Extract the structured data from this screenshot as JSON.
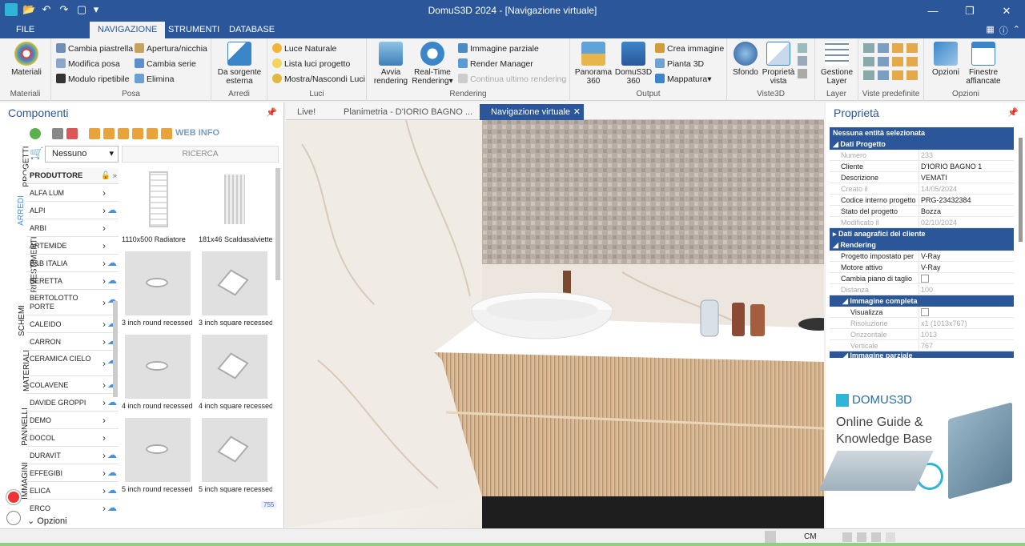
{
  "window": {
    "title": "DomuS3D 2024 - [Navigazione virtuale]",
    "controls": [
      "minimize-icon",
      "restore-icon",
      "close-icon"
    ]
  },
  "ribbon_tabs": [
    {
      "label": "FILE",
      "active": false
    },
    {
      "label": "NAVIGAZIONE",
      "active": true
    },
    {
      "label": "STRUMENTI",
      "active": false
    },
    {
      "label": "DATABASE",
      "active": false
    }
  ],
  "ribbon": {
    "materiali": {
      "btn": "Materiali",
      "group": "Materiali"
    },
    "posa": {
      "items": [
        "Cambia piastrella",
        "Modifica posa",
        "Modulo ripetibile",
        "Apertura/nicchia",
        "Cambia serie",
        "Elimina"
      ],
      "group": "Posa"
    },
    "arredi": {
      "btn_line1": "Da sorgente",
      "btn_line2": "esterna",
      "group": "Arredi"
    },
    "luci": {
      "items": [
        "Luce Naturale",
        "Lista luci progetto",
        "Mostra/Nascondi Luci"
      ],
      "group": "Luci"
    },
    "rendering": {
      "avvia_1": "Avvia",
      "avvia_2": "rendering",
      "rt_1": "Real-Time",
      "rt_2": "Rendering",
      "items": [
        "Immagine parziale",
        "Render Manager",
        "Continua ultimo rendering"
      ],
      "group": "Rendering"
    },
    "output": {
      "pan_1": "Panorama",
      "pan_2": "360",
      "dom_1": "DomuS3D",
      "dom_2": "360",
      "items": [
        "Crea immagine",
        "Pianta 3D",
        "Mappatura"
      ],
      "group": "Output"
    },
    "viste3d": {
      "sfondo": "Sfondo",
      "prop_1": "Proprietà",
      "prop_2": "vista",
      "group": "Viste3D"
    },
    "layer": {
      "btn_1": "Gestione",
      "btn_2": "Layer",
      "group": "Layer"
    },
    "viste_predefinite": {
      "group": "Viste predefinite"
    },
    "opzioni": {
      "btn": "Opzioni",
      "fin_1": "Finestre",
      "fin_2": "affiancate",
      "group": "Opzioni"
    }
  },
  "left_panel": {
    "title": "Componenti",
    "webinfo": "WEB INFO",
    "dropdown_value": "Nessuno",
    "search_placeholder": "RICERCA",
    "vertical_tabs": [
      "PROGETTI",
      "ARREDI",
      "RIVESTIMENTI",
      "SCHEMI",
      "MATERIALI",
      "PANNELLI",
      "IMMAGINI"
    ],
    "list_header": "PRODUTTORE",
    "producers": [
      {
        "name": "ALFA LUM",
        "cloud": false
      },
      {
        "name": "ALPI",
        "cloud": true
      },
      {
        "name": "ARBI",
        "cloud": false
      },
      {
        "name": "ARTEMIDE",
        "cloud": false
      },
      {
        "name": "B&B ITALIA",
        "cloud": true
      },
      {
        "name": "BERETTA",
        "cloud": true
      },
      {
        "name": "BERTOLOTTO PORTE",
        "cloud": true
      },
      {
        "name": "CALEIDO",
        "cloud": true
      },
      {
        "name": "CARRON",
        "cloud": true
      },
      {
        "name": "CERAMICA CIELO",
        "cloud": true
      },
      {
        "name": "COLAVENE",
        "cloud": true
      },
      {
        "name": "DAVIDE GROPPI",
        "cloud": true
      },
      {
        "name": "DEMO",
        "cloud": false
      },
      {
        "name": "DOCOL",
        "cloud": false
      },
      {
        "name": "DURAVIT",
        "cloud": true
      },
      {
        "name": "EFFEGIBI",
        "cloud": true
      },
      {
        "name": "ELICA",
        "cloud": true
      },
      {
        "name": "ERCO",
        "cloud": true
      }
    ],
    "thumbnails": [
      "1110x500 Radiatore",
      "181x46 Scaldasalviette",
      "3 inch round recessed",
      "3 inch square recessed",
      "4 inch round recessed",
      "4 inch square recessed",
      "5 inch round recessed",
      "5 inch square recessed"
    ],
    "count": "755",
    "options_label": "Opzioni"
  },
  "center": {
    "tabs": [
      {
        "label": "Live!",
        "active": false
      },
      {
        "label": "Planimetria - D'IORIO BAGNO ...",
        "active": false
      },
      {
        "label": "Navigazione virtuale",
        "active": true
      }
    ]
  },
  "right_panel": {
    "title": "Proprietà",
    "no_selection": "Nessuna entità selezionata",
    "sections": {
      "dati_progetto": "Dati Progetto",
      "dati_cliente": "Dati anagrafici del cliente",
      "rendering": "Rendering",
      "immagine_completa": "Immagine completa",
      "immagine_parziale": "Immagine parziale"
    },
    "dati_progetto_rows": [
      {
        "k": "Numero",
        "v": "233",
        "dim": true
      },
      {
        "k": "Cliente",
        "v": "D'IORIO BAGNO 1",
        "dim": false
      },
      {
        "k": "Descrizione",
        "v": "VEMATI",
        "dim": false
      },
      {
        "k": "Creato il",
        "v": "14/05/2024",
        "dim": true
      },
      {
        "k": "Codice interno progetto",
        "v": "PRG-23432384",
        "dim": false
      },
      {
        "k": "Stato del progetto",
        "v": "Bozza",
        "dim": false
      },
      {
        "k": "Modificato il",
        "v": "02/10/2024",
        "dim": true
      }
    ],
    "rendering_rows": [
      {
        "k": "Progetto impostato per",
        "v": "V-Ray",
        "dim": false
      },
      {
        "k": "Motore attivo",
        "v": "V-Ray",
        "dim": false
      },
      {
        "k": "Cambia piano di taglio",
        "v": "",
        "dim": false
      },
      {
        "k": "Distanza",
        "v": "100",
        "dim": true
      }
    ],
    "immagine_rows": [
      {
        "k": "Visualizza",
        "v": "",
        "dim": false
      },
      {
        "k": "Risoluzione",
        "v": "x1 (1013x767)",
        "dim": true
      },
      {
        "k": "Orizzontale",
        "v": "1013",
        "dim": true
      },
      {
        "k": "Verticale",
        "v": "767",
        "dim": true
      }
    ],
    "guide": {
      "brand": "DOMUS3D",
      "line1": "Online Guide &",
      "line2": "Knowledge Base"
    }
  },
  "status": {
    "unit": "CM"
  },
  "colors": {
    "accent": "#2b579a",
    "ribbon_bg": "#f3f3f3"
  }
}
